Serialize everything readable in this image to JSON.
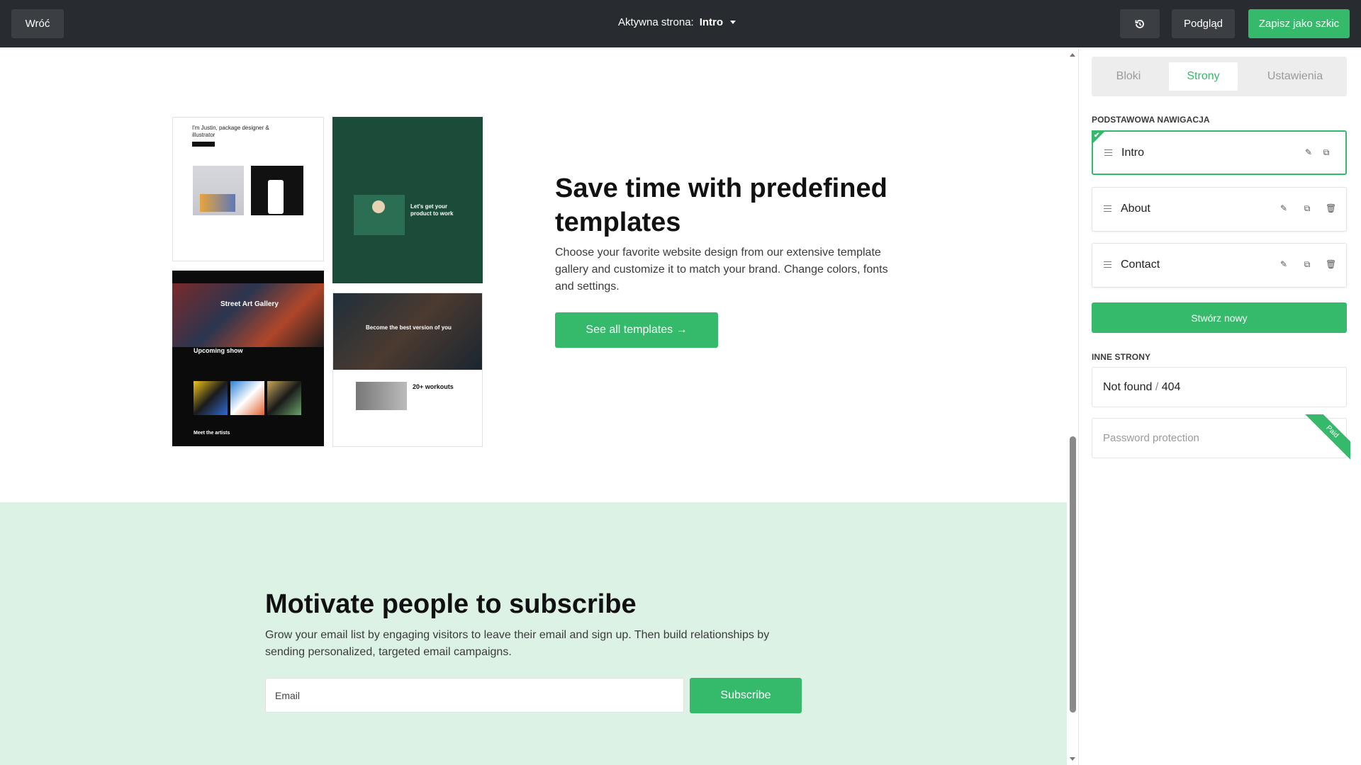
{
  "topbar": {
    "back_label": "Wróć",
    "active_page_prefix": "Aktywna strona:",
    "active_page_value": "Intro",
    "preview_label": "Podgląd",
    "save_draft_label": "Zapisz jako szkic",
    "history_icon": "history-icon"
  },
  "canvas": {
    "templates_section": {
      "heading": "Save time with predefined templates",
      "description": "Choose your favorite website design from our extensive template gallery and customize it to match your brand. Change colors, fonts and settings.",
      "cta_label": "See all templates →",
      "thumbnails": {
        "t1_text": "I'm Justin, package designer & illustrator",
        "t2_text": "Let's get your product to work",
        "t3_title": "Street Art Gallery",
        "t3_sub": "Upcoming show",
        "t3_meet": "Meet the artists",
        "t4_text": "Become the best version of you",
        "t4_workouts": "20+ workouts"
      }
    },
    "subscribe_section": {
      "heading": "Motivate people to subscribe",
      "description": "Grow your email list by engaging visitors to leave their email and sign up. Then build relationships by sending personalized, targeted email campaigns.",
      "email_placeholder": "Email",
      "subscribe_label": "Subscribe"
    }
  },
  "panel": {
    "tabs": [
      "Bloki",
      "Strony",
      "Ustawienia"
    ],
    "active_tab": "Strony",
    "main_nav_title": "PODSTAWOWA NAWIGACJA",
    "main_nav_items": [
      {
        "label": "Intro",
        "active": true
      },
      {
        "label": "About",
        "active": false
      },
      {
        "label": "Contact",
        "active": false
      }
    ],
    "create_new_label": "Stwórz nowy",
    "other_pages_title": "INNE STRONY",
    "not_found_label": "Not found",
    "not_found_sep": " / ",
    "not_found_code": "404",
    "password_label": "Password protection",
    "paid_badge": "Paid"
  },
  "colors": {
    "accent": "#35b96a",
    "topbar_bg": "#282b2f",
    "subscribe_bg": "#dbf2e4"
  }
}
